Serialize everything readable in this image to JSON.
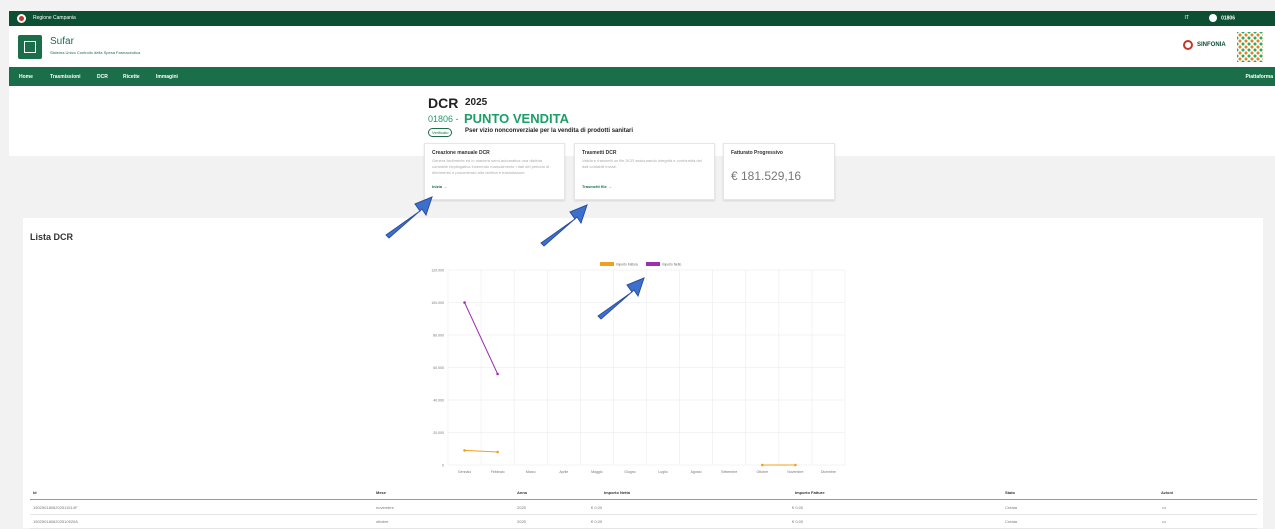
{
  "topbar": {
    "region": "Regione Campania",
    "lang": "IT",
    "user": "01806"
  },
  "header": {
    "app_name": "Sufar",
    "app_subtitle": "Sistema Unico Controllo della Spesa Farmaceutica",
    "brand": "SINFONIA"
  },
  "nav": {
    "items": [
      "Home",
      "Trasmissioni",
      "DCR",
      "Ricette",
      "Immagini"
    ],
    "right": "Piattaforma"
  },
  "page": {
    "title": "DCR",
    "year": "2025",
    "pv_code": "01806 -",
    "pv_name": "PUNTO VENDITA",
    "pill": "Verificato",
    "pv_desc": "Pser vizio nonconverziale per la vendita di prodotti sanitari"
  },
  "cards": [
    {
      "title": "Creazione manuale DCR",
      "desc": "Genera facilmente ed in maniera semi-automatica una distinta contabile riepilogativa inserendo manualmente i dati del periodo di riferimento e procedendo alla verifica e trasmissione.",
      "link": "Inizia"
    },
    {
      "title": "Trasmetti DCR",
      "desc": "Valida e trasmetti un file DCR assicurando integrità e conformità dei dati contabili inviati.",
      "link": "Trasmetti file"
    },
    {
      "title": "Fatturato Progressivo",
      "value": "€ 181.529,16"
    }
  ],
  "list_title": "Lista DCR",
  "chart_data": {
    "type": "line",
    "categories": [
      "Gennaio",
      "Febbraio",
      "Marzo",
      "Aprile",
      "Maggio",
      "Giugno",
      "Luglio",
      "Agosto",
      "Settembre",
      "Ottobre",
      "Novembre",
      "Dicembre"
    ],
    "y_ticks": [
      "0",
      "20.000",
      "40.000",
      "60.000",
      "80.000",
      "100.000",
      "120.000"
    ],
    "ylim": [
      0,
      120000
    ],
    "grid": true,
    "legend_position": "top",
    "series": [
      {
        "name": "Importo Fattura",
        "color": "#f0a020",
        "values": [
          9000,
          8000,
          null,
          null,
          null,
          null,
          null,
          null,
          null,
          0,
          0,
          null
        ]
      },
      {
        "name": "Importo Netto",
        "color": "#9b30b0",
        "values": [
          100000,
          56000,
          null,
          null,
          null,
          null,
          null,
          null,
          null,
          null,
          null,
          null
        ]
      }
    ]
  },
  "table": {
    "headers": [
      "Id",
      "Mese",
      "Anno",
      "Importo Netto",
      "Importo Fatture",
      "Stato",
      "Azioni"
    ],
    "rows": [
      [
        "1502501806202511514F",
        "novembre",
        "2025",
        "€ 0,00",
        "€ 0,00",
        "Creata",
        "•••"
      ],
      [
        "1502501806202510520A",
        "ottobre",
        "2025",
        "€ 0,00",
        "€ 0,00",
        "Creata",
        "•••"
      ]
    ]
  },
  "colors": {
    "dark_green": "#0d4f33",
    "green": "#1b6e4a",
    "accent_green": "#1b9e6a",
    "arrow": "#3d6fcf"
  }
}
